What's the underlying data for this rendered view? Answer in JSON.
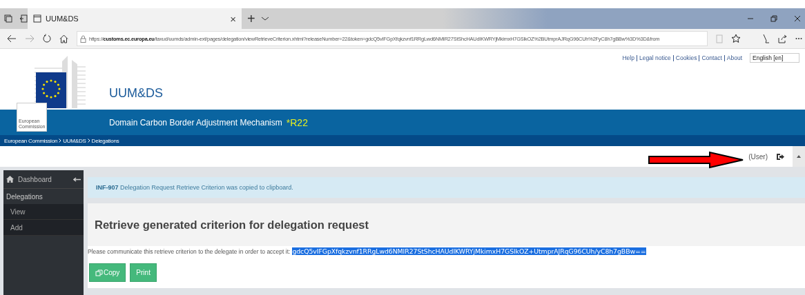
{
  "browser": {
    "tab_title": "UUM&DS",
    "tab_close": "×",
    "new_tab": "+",
    "address": "https://**customs.ec.europa.eu**/taxud/uumds/admin-ext/pages/delegation/viewRetrieveCriterion.xhtml?releaseNumber=22&token=gdcQ5vIFGpXfqkzvnf1RRgLwd6NMIR27StShcHAUdIKWRYjMkimxH7GSlkOZ%2BUtmprAJRqG96CUh%2FyC8h7gBBw%3D%3D&from"
  },
  "top_links": [
    "Help",
    "Legal notice",
    "Cookies",
    "Contact",
    "About"
  ],
  "language": "English [en]",
  "logo_text": "European Commission",
  "app_title": "UUM&DS",
  "domain": "Domain Carbon Border Adjustment Mechanism",
  "release": "*R22",
  "breadcrumb": [
    "European Commission",
    "UUM&DS",
    "Delegations"
  ],
  "user": "(User)",
  "sidebar": {
    "dashboard": "Dashboard",
    "section": "Delegations",
    "items": [
      {
        "label": "View"
      },
      {
        "label": "Add"
      }
    ]
  },
  "message": {
    "code": "INF-907",
    "text": "Delegation Request Retrieve Criterion was copied to clipboard."
  },
  "heading": "Retrieve generated criterion for delegation request",
  "instruction": "Please communicate this retrieve criterion to the delegate in order to accept it:",
  "criterion": "gdcQ5vIFGpXfqkzvnf1RRgLwd6NMIR27StShcHAUdIKWRYjMkimxH7GSlkOZ+UtmprAJRqG96CUh/yC8h7gBBw==",
  "buttons": [
    {
      "kind": "copy",
      "label": "Copy"
    },
    {
      "kind": "print",
      "label": "Print"
    }
  ]
}
